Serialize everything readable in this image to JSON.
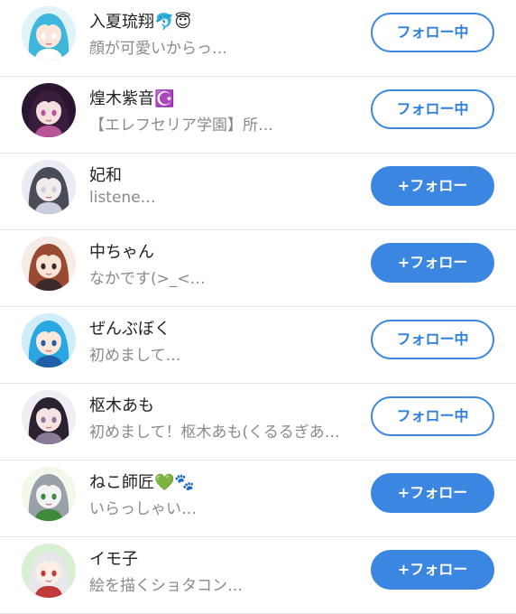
{
  "colors": {
    "accent": "#3a86e0",
    "name_text": "#222222",
    "bio_text": "#8a8a8a",
    "divider": "#e3e3e3"
  },
  "users": [
    {
      "name": "入夏琉翔🐬😇",
      "bio": "顔が可愛いからっ…",
      "button": "フォロー中",
      "following": true,
      "avatar": {
        "icon": "avatar-icon",
        "bg": "#dff3f8",
        "hair": "#3fb6dc",
        "skin": "#fde6da",
        "accent": "#ffffff"
      }
    },
    {
      "name": "煌木紫音☪️",
      "bio": "【エレフセリア学園】所…",
      "button": "フォロー中",
      "following": true,
      "avatar": {
        "icon": "avatar-icon",
        "bg": "#2a1630",
        "hair": "#3a1c3c",
        "skin": "#f6dfe0",
        "accent": "#b8549a"
      }
    },
    {
      "name": "妃和",
      "bio": "listene…",
      "button": "+フォロー",
      "following": false,
      "avatar": {
        "icon": "avatar-icon",
        "bg": "#e9ecf2",
        "hair": "#4a4d58",
        "skin": "#f4ecea",
        "accent": "#c9cfdc"
      }
    },
    {
      "name": "中ちゃん",
      "bio": "なかです(>_<…",
      "button": "+フォロー",
      "following": false,
      "avatar": {
        "icon": "avatar-icon",
        "bg": "#f6ece6",
        "hair": "#9a4a32",
        "skin": "#fbe3d6",
        "accent": "#3a2a2a"
      }
    },
    {
      "name": "ぜんぶぼく",
      "bio": "初めまして…",
      "button": "フォロー中",
      "following": true,
      "avatar": {
        "icon": "avatar-icon",
        "bg": "#cfeefa",
        "hair": "#2aa7e0",
        "skin": "#fde6da",
        "accent": "#1e5fa8"
      }
    },
    {
      "name": "枢木あも",
      "bio": "初めまして！枢木あも(くるるぎあ…",
      "button": "フォロー中",
      "following": true,
      "avatar": {
        "icon": "avatar-icon",
        "bg": "#f1eef3",
        "hair": "#2a2230",
        "skin": "#f6e4e4",
        "accent": "#8a7a9a"
      }
    },
    {
      "name": "ねこ師匠💚🐾",
      "bio": "いらっしゃい…",
      "button": "+フォロー",
      "following": false,
      "avatar": {
        "icon": "avatar-icon",
        "bg": "#f3f9ea",
        "hair": "#9aa0a8",
        "skin": "#f3f3f3",
        "accent": "#3d8a3d"
      }
    },
    {
      "name": "イモ子",
      "bio": "絵を描くショタコン…",
      "button": "+フォロー",
      "following": false,
      "avatar": {
        "icon": "avatar-icon",
        "bg": "#d9f0d2",
        "hair": "#e8e8ec",
        "skin": "#fbeee6",
        "accent": "#c03a3a"
      }
    }
  ]
}
